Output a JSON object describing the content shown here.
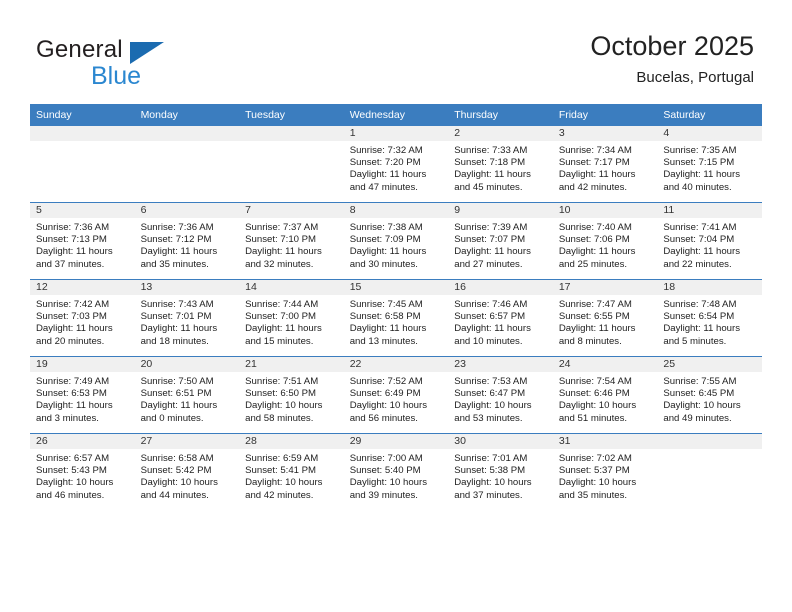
{
  "brand": {
    "name_part1": "General",
    "name_part2": "Blue",
    "color_dark": "#231f20",
    "color_blue": "#2b87d0",
    "triangle_color": "#1b6bb0"
  },
  "header": {
    "title": "October 2025",
    "subtitle": "Bucelas, Portugal"
  },
  "theme": {
    "header_row_bg": "#3B7DBF",
    "header_row_text": "#FFFFFF",
    "daynum_strip_bg": "#F0F0F0",
    "cell_bg": "#FFFFFF",
    "grid_line": "#3B7DBF"
  },
  "weekday_headers": [
    "Sunday",
    "Monday",
    "Tuesday",
    "Wednesday",
    "Thursday",
    "Friday",
    "Saturday"
  ],
  "labels": {
    "sunrise_prefix": "Sunrise: ",
    "sunset_prefix": "Sunset: ",
    "daylight_prefix": "Daylight: "
  },
  "weeks": [
    [
      {
        "day": "",
        "empty": true
      },
      {
        "day": "",
        "empty": true
      },
      {
        "day": "",
        "empty": true
      },
      {
        "day": "1",
        "sunrise": "Sunrise: 7:32 AM",
        "sunset": "Sunset: 7:20 PM",
        "daylight_line1": "Daylight: 11 hours",
        "daylight_line2": "and 47 minutes."
      },
      {
        "day": "2",
        "sunrise": "Sunrise: 7:33 AM",
        "sunset": "Sunset: 7:18 PM",
        "daylight_line1": "Daylight: 11 hours",
        "daylight_line2": "and 45 minutes."
      },
      {
        "day": "3",
        "sunrise": "Sunrise: 7:34 AM",
        "sunset": "Sunset: 7:17 PM",
        "daylight_line1": "Daylight: 11 hours",
        "daylight_line2": "and 42 minutes."
      },
      {
        "day": "4",
        "sunrise": "Sunrise: 7:35 AM",
        "sunset": "Sunset: 7:15 PM",
        "daylight_line1": "Daylight: 11 hours",
        "daylight_line2": "and 40 minutes."
      }
    ],
    [
      {
        "day": "5",
        "sunrise": "Sunrise: 7:36 AM",
        "sunset": "Sunset: 7:13 PM",
        "daylight_line1": "Daylight: 11 hours",
        "daylight_line2": "and 37 minutes."
      },
      {
        "day": "6",
        "sunrise": "Sunrise: 7:36 AM",
        "sunset": "Sunset: 7:12 PM",
        "daylight_line1": "Daylight: 11 hours",
        "daylight_line2": "and 35 minutes."
      },
      {
        "day": "7",
        "sunrise": "Sunrise: 7:37 AM",
        "sunset": "Sunset: 7:10 PM",
        "daylight_line1": "Daylight: 11 hours",
        "daylight_line2": "and 32 minutes."
      },
      {
        "day": "8",
        "sunrise": "Sunrise: 7:38 AM",
        "sunset": "Sunset: 7:09 PM",
        "daylight_line1": "Daylight: 11 hours",
        "daylight_line2": "and 30 minutes."
      },
      {
        "day": "9",
        "sunrise": "Sunrise: 7:39 AM",
        "sunset": "Sunset: 7:07 PM",
        "daylight_line1": "Daylight: 11 hours",
        "daylight_line2": "and 27 minutes."
      },
      {
        "day": "10",
        "sunrise": "Sunrise: 7:40 AM",
        "sunset": "Sunset: 7:06 PM",
        "daylight_line1": "Daylight: 11 hours",
        "daylight_line2": "and 25 minutes."
      },
      {
        "day": "11",
        "sunrise": "Sunrise: 7:41 AM",
        "sunset": "Sunset: 7:04 PM",
        "daylight_line1": "Daylight: 11 hours",
        "daylight_line2": "and 22 minutes."
      }
    ],
    [
      {
        "day": "12",
        "sunrise": "Sunrise: 7:42 AM",
        "sunset": "Sunset: 7:03 PM",
        "daylight_line1": "Daylight: 11 hours",
        "daylight_line2": "and 20 minutes."
      },
      {
        "day": "13",
        "sunrise": "Sunrise: 7:43 AM",
        "sunset": "Sunset: 7:01 PM",
        "daylight_line1": "Daylight: 11 hours",
        "daylight_line2": "and 18 minutes."
      },
      {
        "day": "14",
        "sunrise": "Sunrise: 7:44 AM",
        "sunset": "Sunset: 7:00 PM",
        "daylight_line1": "Daylight: 11 hours",
        "daylight_line2": "and 15 minutes."
      },
      {
        "day": "15",
        "sunrise": "Sunrise: 7:45 AM",
        "sunset": "Sunset: 6:58 PM",
        "daylight_line1": "Daylight: 11 hours",
        "daylight_line2": "and 13 minutes."
      },
      {
        "day": "16",
        "sunrise": "Sunrise: 7:46 AM",
        "sunset": "Sunset: 6:57 PM",
        "daylight_line1": "Daylight: 11 hours",
        "daylight_line2": "and 10 minutes."
      },
      {
        "day": "17",
        "sunrise": "Sunrise: 7:47 AM",
        "sunset": "Sunset: 6:55 PM",
        "daylight_line1": "Daylight: 11 hours",
        "daylight_line2": "and 8 minutes."
      },
      {
        "day": "18",
        "sunrise": "Sunrise: 7:48 AM",
        "sunset": "Sunset: 6:54 PM",
        "daylight_line1": "Daylight: 11 hours",
        "daylight_line2": "and 5 minutes."
      }
    ],
    [
      {
        "day": "19",
        "sunrise": "Sunrise: 7:49 AM",
        "sunset": "Sunset: 6:53 PM",
        "daylight_line1": "Daylight: 11 hours",
        "daylight_line2": "and 3 minutes."
      },
      {
        "day": "20",
        "sunrise": "Sunrise: 7:50 AM",
        "sunset": "Sunset: 6:51 PM",
        "daylight_line1": "Daylight: 11 hours",
        "daylight_line2": "and 0 minutes."
      },
      {
        "day": "21",
        "sunrise": "Sunrise: 7:51 AM",
        "sunset": "Sunset: 6:50 PM",
        "daylight_line1": "Daylight: 10 hours",
        "daylight_line2": "and 58 minutes."
      },
      {
        "day": "22",
        "sunrise": "Sunrise: 7:52 AM",
        "sunset": "Sunset: 6:49 PM",
        "daylight_line1": "Daylight: 10 hours",
        "daylight_line2": "and 56 minutes."
      },
      {
        "day": "23",
        "sunrise": "Sunrise: 7:53 AM",
        "sunset": "Sunset: 6:47 PM",
        "daylight_line1": "Daylight: 10 hours",
        "daylight_line2": "and 53 minutes."
      },
      {
        "day": "24",
        "sunrise": "Sunrise: 7:54 AM",
        "sunset": "Sunset: 6:46 PM",
        "daylight_line1": "Daylight: 10 hours",
        "daylight_line2": "and 51 minutes."
      },
      {
        "day": "25",
        "sunrise": "Sunrise: 7:55 AM",
        "sunset": "Sunset: 6:45 PM",
        "daylight_line1": "Daylight: 10 hours",
        "daylight_line2": "and 49 minutes."
      }
    ],
    [
      {
        "day": "26",
        "sunrise": "Sunrise: 6:57 AM",
        "sunset": "Sunset: 5:43 PM",
        "daylight_line1": "Daylight: 10 hours",
        "daylight_line2": "and 46 minutes."
      },
      {
        "day": "27",
        "sunrise": "Sunrise: 6:58 AM",
        "sunset": "Sunset: 5:42 PM",
        "daylight_line1": "Daylight: 10 hours",
        "daylight_line2": "and 44 minutes."
      },
      {
        "day": "28",
        "sunrise": "Sunrise: 6:59 AM",
        "sunset": "Sunset: 5:41 PM",
        "daylight_line1": "Daylight: 10 hours",
        "daylight_line2": "and 42 minutes."
      },
      {
        "day": "29",
        "sunrise": "Sunrise: 7:00 AM",
        "sunset": "Sunset: 5:40 PM",
        "daylight_line1": "Daylight: 10 hours",
        "daylight_line2": "and 39 minutes."
      },
      {
        "day": "30",
        "sunrise": "Sunrise: 7:01 AM",
        "sunset": "Sunset: 5:38 PM",
        "daylight_line1": "Daylight: 10 hours",
        "daylight_line2": "and 37 minutes."
      },
      {
        "day": "31",
        "sunrise": "Sunrise: 7:02 AM",
        "sunset": "Sunset: 5:37 PM",
        "daylight_line1": "Daylight: 10 hours",
        "daylight_line2": "and 35 minutes."
      },
      {
        "day": "",
        "empty": true
      }
    ]
  ]
}
